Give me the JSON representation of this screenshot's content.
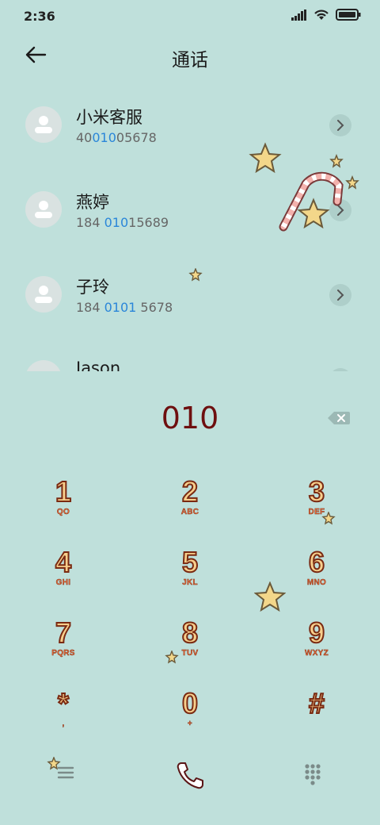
{
  "status": {
    "time": "2:36"
  },
  "header": {
    "title": "通话"
  },
  "contacts": [
    {
      "name": "小米客服",
      "num_pre": "40",
      "num_hl": "010",
      "num_post": "05678"
    },
    {
      "name": "燕婷",
      "num_pre": "184 ",
      "num_hl": "010",
      "num_post": "15689"
    },
    {
      "name": "子玲",
      "num_pre": "184 ",
      "num_hl": "0101",
      "num_post": " 5678"
    },
    {
      "name": "Jason",
      "num_pre": "",
      "num_hl": "",
      "num_post": ""
    }
  ],
  "dialer": {
    "input": "010",
    "keys": [
      {
        "digit": "1",
        "letters": "QO"
      },
      {
        "digit": "2",
        "letters": "ABC"
      },
      {
        "digit": "3",
        "letters": "DEF"
      },
      {
        "digit": "4",
        "letters": "GHI"
      },
      {
        "digit": "5",
        "letters": "JKL"
      },
      {
        "digit": "6",
        "letters": "MNO"
      },
      {
        "digit": "7",
        "letters": "PQRS"
      },
      {
        "digit": "8",
        "letters": "TUV"
      },
      {
        "digit": "9",
        "letters": "WXYZ"
      },
      {
        "digit": "*",
        "letters": ","
      },
      {
        "digit": "0",
        "letters": "+"
      },
      {
        "digit": "#",
        "letters": ""
      }
    ]
  },
  "icons": {
    "back": "arrow-left-icon",
    "backspace": "backspace-icon",
    "menu": "menu-icon",
    "call": "phone-icon",
    "keypad": "dialpad-icon"
  },
  "colors": {
    "background": "#bfe0db",
    "highlight": "#2a86d9",
    "input_text": "#6e0f0f",
    "key_fill": "#f7cf8c"
  }
}
